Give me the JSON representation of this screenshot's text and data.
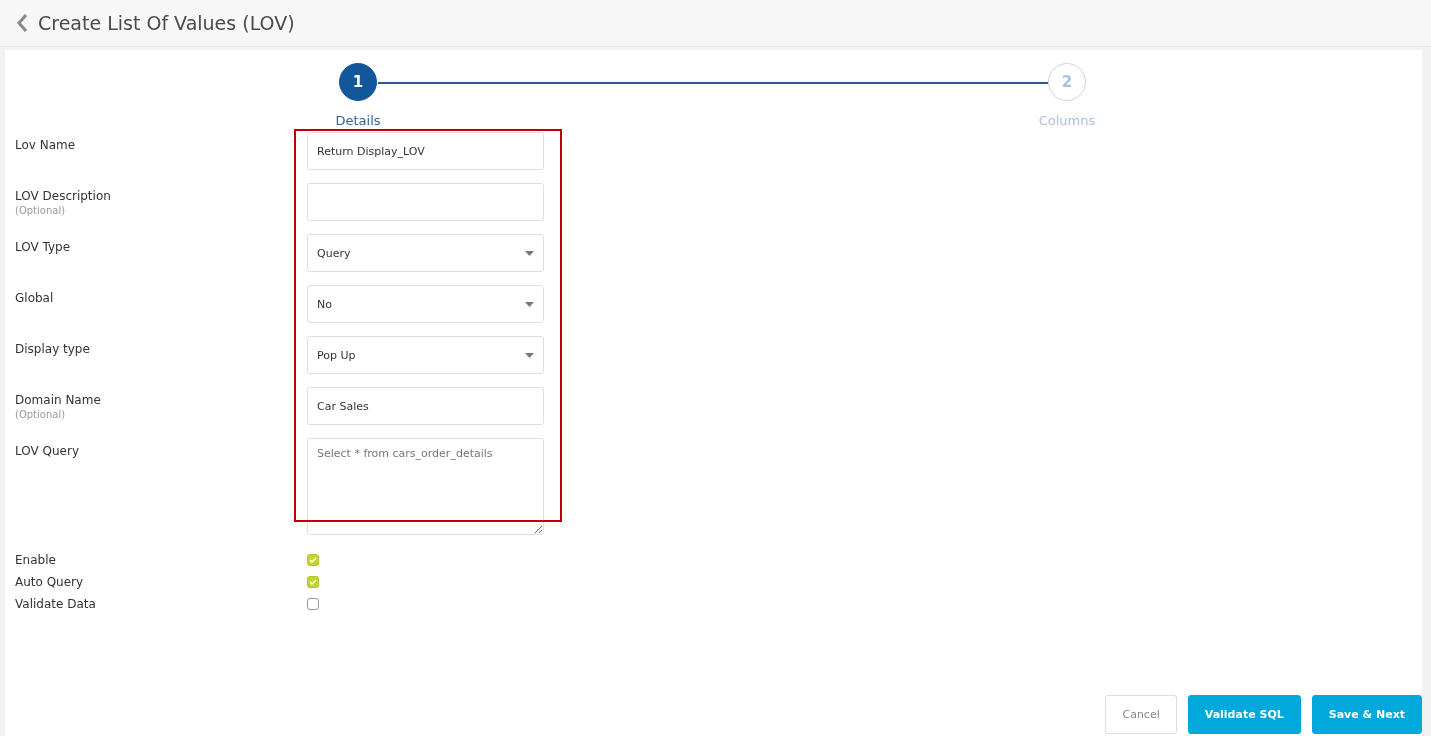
{
  "header": {
    "title": "Create List Of Values (LOV)"
  },
  "steps": [
    {
      "number": "1",
      "label": "Details",
      "selected": true
    },
    {
      "number": "2",
      "label": "Columns",
      "selected": false
    }
  ],
  "fields": [
    {
      "kind": "text",
      "label": "Lov Name",
      "value": "Return Display_LOV"
    },
    {
      "kind": "text",
      "label": "LOV Description",
      "hint": "(Optional)"
    },
    {
      "kind": "select",
      "label": "LOV Type",
      "value": "Query"
    },
    {
      "kind": "select",
      "label": "Global",
      "value": "No"
    },
    {
      "kind": "select",
      "label": "Display type",
      "value": "Pop Up"
    },
    {
      "kind": "text",
      "label": "Domain Name",
      "hint": "(Optional)",
      "value": "Car Sales"
    },
    {
      "kind": "textarea",
      "label": "LOV Query",
      "placeholder": "Select * from cars_order_details"
    }
  ],
  "highlight_frame": {
    "shown": true
  },
  "checks": [
    {
      "label": "Enable",
      "checked": true
    },
    {
      "label": "Auto Query",
      "checked": true
    },
    {
      "label": "Validate Data",
      "checked": false
    }
  ],
  "buttons": [
    {
      "kind": "secondary",
      "label": "Cancel"
    },
    {
      "kind": "primary",
      "label": "Validate SQL"
    },
    {
      "kind": "primary",
      "label": "Save & Next"
    }
  ]
}
